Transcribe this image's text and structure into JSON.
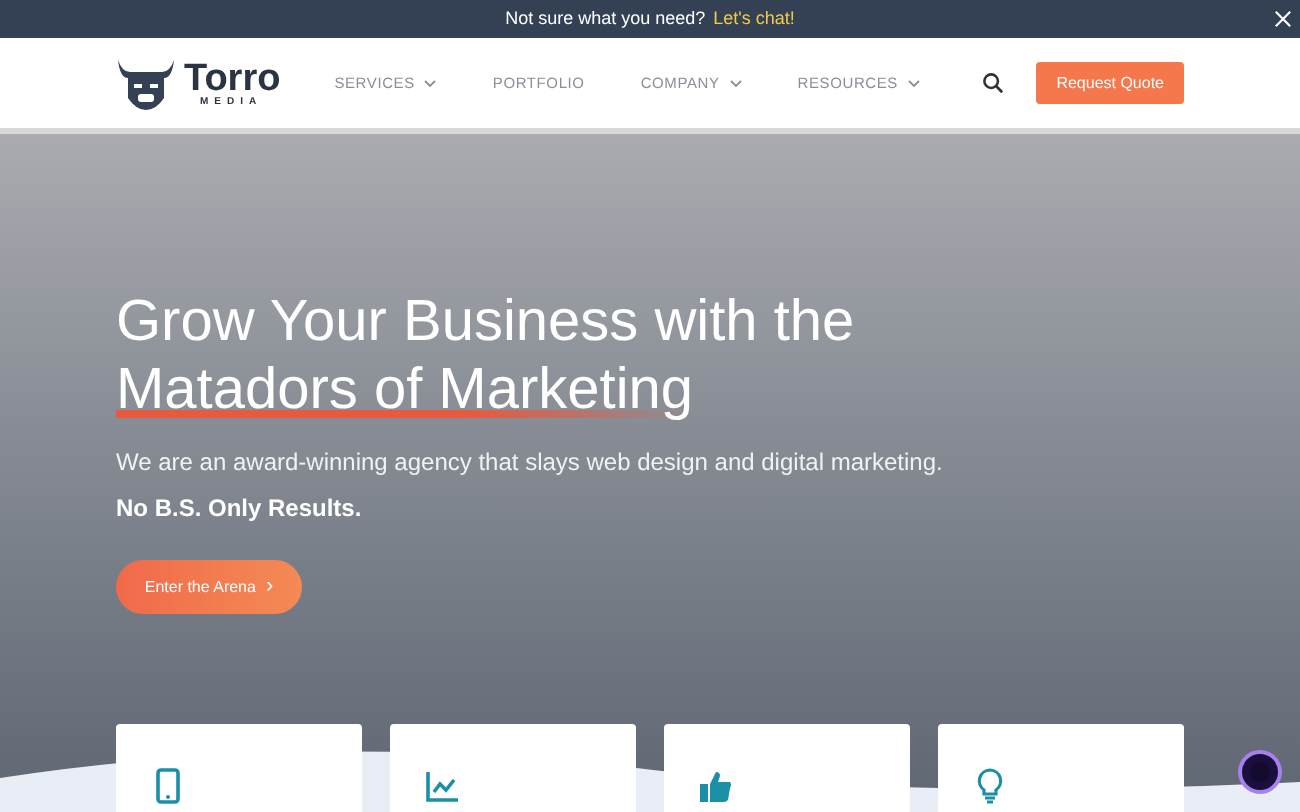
{
  "announcement": {
    "text": "Not sure what you need?",
    "link": "Let's chat!"
  },
  "logo": {
    "name": "Torro",
    "tagline": "MEDIA"
  },
  "nav": [
    {
      "label": "SERVICES",
      "has_dropdown": true
    },
    {
      "label": "PORTFOLIO",
      "has_dropdown": false
    },
    {
      "label": "COMPANY",
      "has_dropdown": true
    },
    {
      "label": "RESOURCES",
      "has_dropdown": true
    }
  ],
  "cta_button": "Request Quote",
  "hero": {
    "title_start": "Grow Your Business with the",
    "title_highlight": "Matadors of Marketing",
    "subtitle": "We are an award-winning agency that slays web design and digital marketing.",
    "tagline": "No B.S. Only Results.",
    "button": "Enter the Arena",
    "button_arrow": "›"
  },
  "cards": [
    {
      "kind": "phone"
    },
    {
      "kind": "chart"
    },
    {
      "kind": "thumb"
    },
    {
      "kind": "bulb"
    }
  ]
}
